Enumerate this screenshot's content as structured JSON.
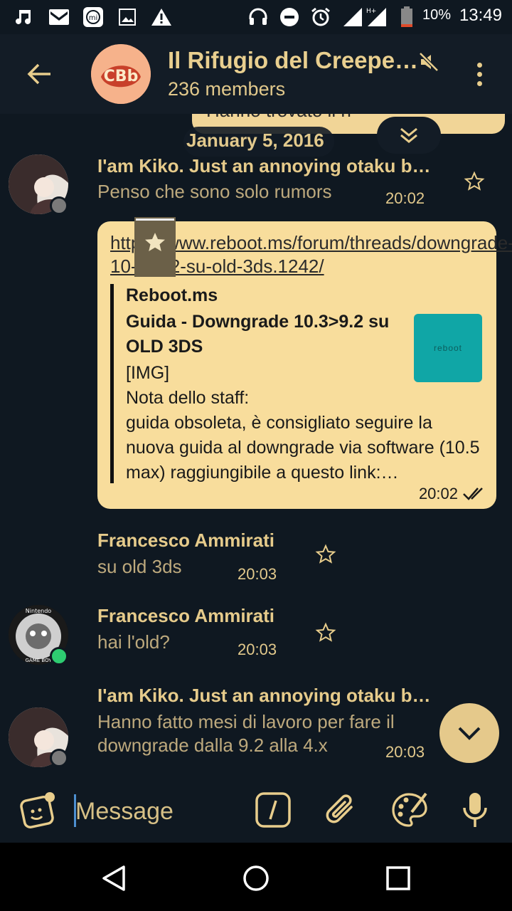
{
  "status_bar": {
    "battery_percent": "10%",
    "time": "13:49",
    "network_type": "H+",
    "icons": [
      "music-icon",
      "gmail-icon",
      "mi-icon",
      "gallery-icon",
      "warning-icon",
      "headset-icon",
      "dnd-icon",
      "alarm-icon",
      "signal-icon",
      "battery-icon"
    ]
  },
  "header": {
    "title": "Il Rifugio del Creepe…",
    "members": "236 members",
    "avatar_text": "CBb"
  },
  "chat": {
    "previous_bubble_text": "Hanno trovato il n",
    "date_label": "January 5, 2016",
    "messages": [
      {
        "sender": "I'am Kiko. Just an annoying otaku b…",
        "text": "Penso che sono solo rumors",
        "time": "20:02"
      },
      {
        "link_url": "https://www.reboot.ms/forum/threads/downgrade-10-3-9-2-su-old-3ds.1242/",
        "preview_site": "Reboot.ms",
        "preview_title": "Guida - Downgrade 10.3>9.2 su OLD 3DS",
        "preview_body": "[IMG]\nNota dello staff:\nguida obsoleta, è consigliato seguire la nuova guida al downgrade via software (10.5 max) raggiungibile a questo link:…",
        "thumbnail_text": "reboot",
        "time": "20:02"
      },
      {
        "sender": "Francesco Ammirati",
        "text": "su old 3ds",
        "time": "20:03"
      },
      {
        "sender": "Francesco Ammirati",
        "text": "hai l'old?",
        "time": "20:03",
        "avatar_top": "Nintendo",
        "avatar_bottom": "GAME BOY"
      },
      {
        "sender": "I'am Kiko. Just an annoying otaku b…",
        "text": "Hanno fatto mesi di lavoro per fare il downgrade dalla 9.2 alla 4.x",
        "time": "20:03"
      }
    ]
  },
  "input": {
    "placeholder": "Message"
  },
  "colors": {
    "background": "#0f1821",
    "accent": "#e8cd8c",
    "bubble": "#f8dd9c",
    "online": "#2ecc71",
    "offline": "#7a7a7a"
  }
}
